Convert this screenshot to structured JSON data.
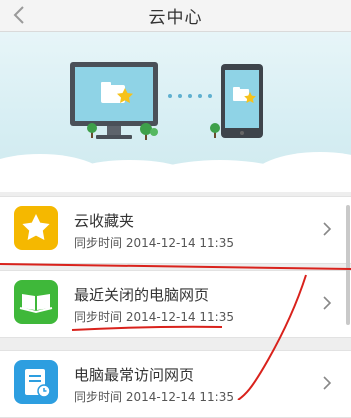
{
  "header": {
    "title": "云中心",
    "back_icon": "chevron-left-icon"
  },
  "items": [
    {
      "name": "云收藏夹",
      "sync_label": "同步时间",
      "sync_time": "2014-12-14 11:35",
      "icon": "star-icon",
      "color": "#f5b800"
    },
    {
      "name": "最近关闭的电脑网页",
      "sync_label": "同步时间",
      "sync_time": "2014-12-14 11:35",
      "icon": "open-book-icon",
      "color": "#3fb83a"
    },
    {
      "name": "电脑最常访问网页",
      "sync_label": "同步时间",
      "sync_time": "2014-12-14 11:35",
      "icon": "document-icon",
      "color": "#2d9ee0"
    }
  ],
  "annotation_color": "#d9221c"
}
